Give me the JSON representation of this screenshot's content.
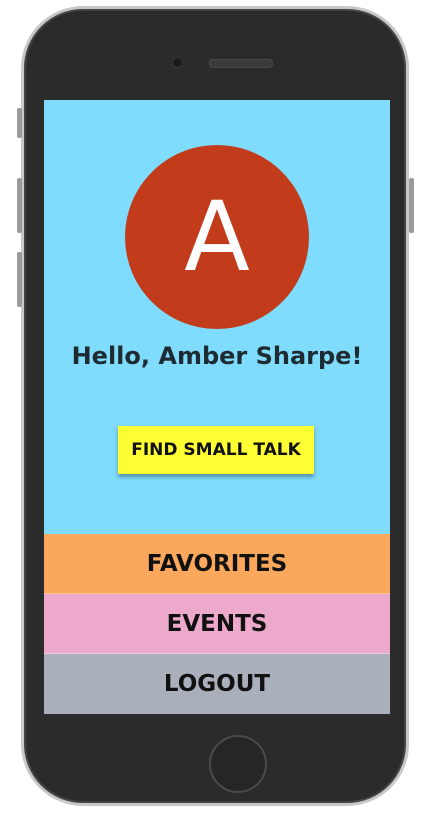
{
  "profile": {
    "avatar_initial": "A",
    "greeting": "Hello, Amber Sharpe!"
  },
  "actions": {
    "find_small_talk_label": "FIND SMALL TALK"
  },
  "menu": {
    "items": [
      {
        "label": "FAVORITES",
        "color": "#fca85c"
      },
      {
        "label": "EVENTS",
        "color": "#eda9cb"
      },
      {
        "label": "LOGOUT",
        "color": "#a9b0bc"
      }
    ]
  },
  "colors": {
    "screen_background": "#80dcfc",
    "avatar_background": "#c23b1a",
    "cta_background": "#ffff33"
  }
}
